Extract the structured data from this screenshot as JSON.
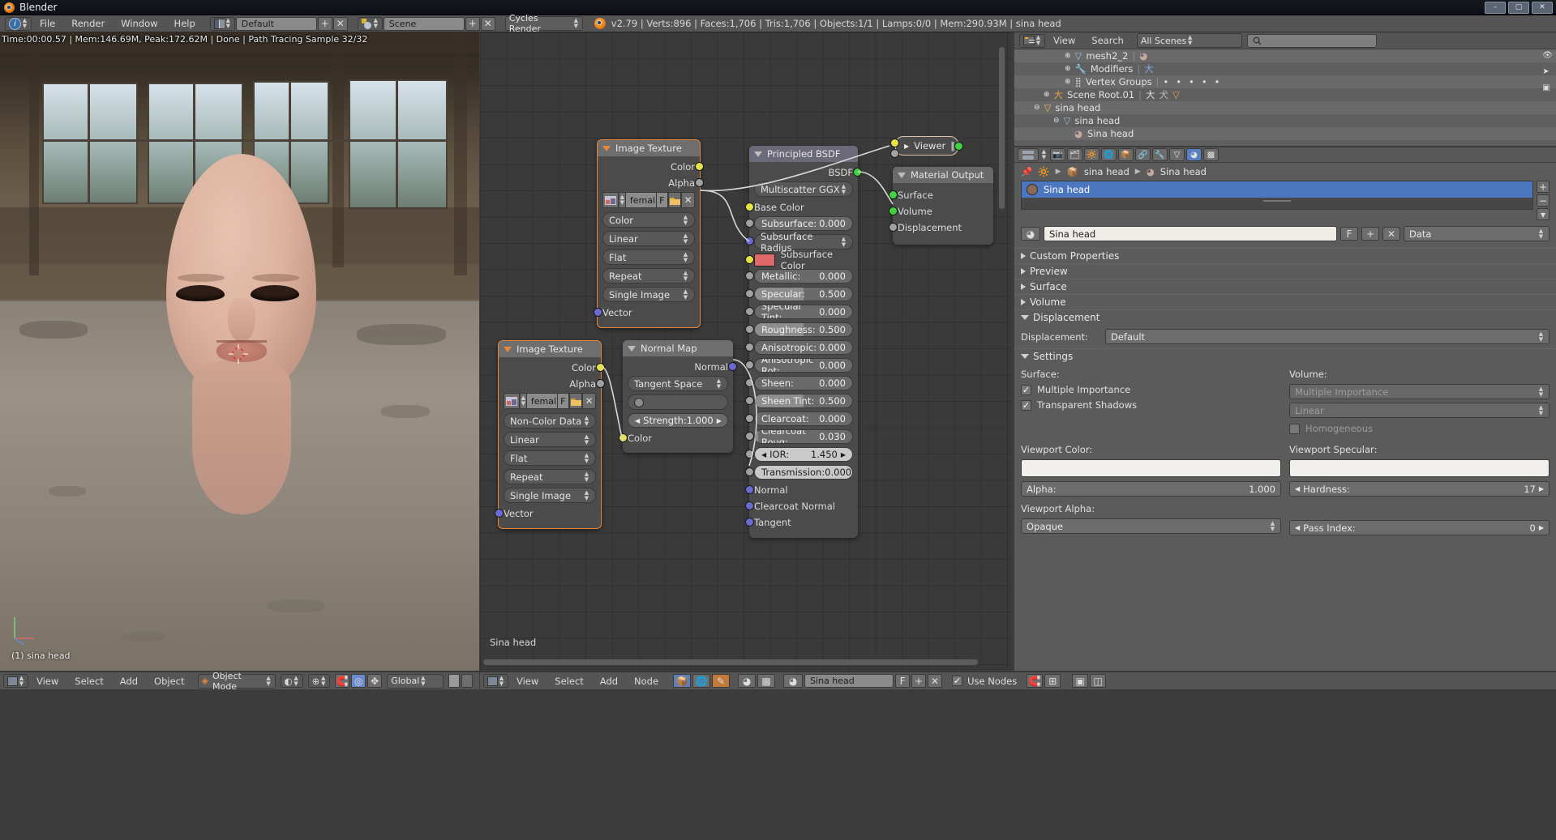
{
  "window": {
    "title": "Blender",
    "min": "–",
    "max": "▢",
    "close": "✕"
  },
  "topbar": {
    "menus": [
      "File",
      "Render",
      "Window",
      "Help"
    ],
    "screen_layout": "Default",
    "scene": "Scene",
    "engine": "Cycles Render",
    "add_label": "+",
    "remove_label": "✕",
    "stats": "v2.79 | Verts:896 | Faces:1,706 | Tris:1,706 | Objects:1/1 | Lamps:0/0 | Mem:290.93M | sina head"
  },
  "viewport": {
    "render_info": "Time:00:00.57 | Mem:146.69M, Peak:172.62M | Done | Path Tracing Sample 32/32",
    "object_label": "(1) sina head"
  },
  "node_editor": {
    "footer": "Sina head",
    "nodes": {
      "image_texture_1": {
        "title": "Image Texture",
        "outputs": [
          "Color",
          "Alpha"
        ],
        "image_name": "femal",
        "fake_user": "F",
        "enums": [
          "Color",
          "Linear",
          "Flat",
          "Repeat",
          "Single Image"
        ],
        "inputs": [
          "Vector"
        ]
      },
      "image_texture_2": {
        "title": "Image Texture",
        "outputs": [
          "Color",
          "Alpha"
        ],
        "image_name": "femal",
        "fake_user": "F",
        "enums": [
          "Non-Color Data",
          "Linear",
          "Flat",
          "Repeat",
          "Single Image"
        ],
        "inputs": [
          "Vector"
        ]
      },
      "normal_map": {
        "title": "Normal Map",
        "outputs": [
          "Normal"
        ],
        "space": "Tangent Space",
        "uv_map": "",
        "strength_label": "Strength:",
        "strength_value": "1.000",
        "inputs": [
          "Color"
        ]
      },
      "principled_bsdf": {
        "title": "Principled BSDF",
        "outputs": [
          "BSDF"
        ],
        "distribution": "Multiscatter GGX",
        "base_color_label": "Base Color",
        "subsurface_radius_label": "Subsurface Radius",
        "subsurface_color_label": "Subsurface Color",
        "subsurface_color_hex": "#e06a6a",
        "sliders": [
          {
            "label": "Subsurface:",
            "value": "0.000",
            "fill": 0
          },
          {
            "label": "Metallic:",
            "value": "0.000",
            "fill": 0
          },
          {
            "label": "Specular:",
            "value": "0.500",
            "fill": 50
          },
          {
            "label": "Specular Tint:",
            "value": "0.000",
            "fill": 0
          },
          {
            "label": "Roughness:",
            "value": "0.500",
            "fill": 50
          },
          {
            "label": "Anisotropic:",
            "value": "0.000",
            "fill": 0
          },
          {
            "label": "Anisotropic Rot:",
            "value": "0.000",
            "fill": 0
          },
          {
            "label": "Sheen:",
            "value": "0.000",
            "fill": 0
          },
          {
            "label": "Sheen Tint:",
            "value": "0.500",
            "fill": 50
          },
          {
            "label": "Clearcoat:",
            "value": "0.000",
            "fill": 0
          },
          {
            "label": "Clearcoat Roug:",
            "value": "0.030",
            "fill": 3
          },
          {
            "label": "IOR:",
            "value": "1.450",
            "fill": 0
          },
          {
            "label": "Transmission:",
            "value": "0.000",
            "fill": 0
          }
        ],
        "vector_inputs": [
          "Normal",
          "Clearcoat Normal",
          "Tangent"
        ]
      },
      "viewer": {
        "title": "Viewer",
        "pause": "‖"
      },
      "material_output": {
        "title": "Material Output",
        "inputs": [
          "Surface",
          "Volume",
          "Displacement"
        ]
      }
    }
  },
  "outliner": {
    "menus": [
      "View",
      "Search"
    ],
    "scope": "All Scenes",
    "search_placeholder": "",
    "rows": [
      {
        "label": "mesh2_2",
        "indent": 62,
        "icon": "mesh-icon"
      },
      {
        "label": "Modifiers",
        "indent": 62,
        "icon": "wrench-icon"
      },
      {
        "label": "Vertex Groups",
        "indent": 62,
        "icon": "group-icon"
      },
      {
        "label": "Scene Root.01",
        "indent": 36,
        "icon": "armature-icon"
      },
      {
        "label": "sina head",
        "indent": 24,
        "icon": "object-icon"
      },
      {
        "label": "sina head",
        "indent": 48,
        "icon": "mesh-icon"
      },
      {
        "label": "Sina head",
        "indent": 68,
        "icon": "material-icon"
      }
    ]
  },
  "properties": {
    "breadcrumb": {
      "object": "sina head",
      "material": "Sina head"
    },
    "material_slot": "Sina head",
    "datablock": {
      "name": "Sina head",
      "fake_user": "F",
      "new": "+",
      "unlink": "✕",
      "type": "Data"
    },
    "panels": [
      {
        "label": "Custom Properties",
        "open": false
      },
      {
        "label": "Preview",
        "open": false
      },
      {
        "label": "Surface",
        "open": false
      },
      {
        "label": "Volume",
        "open": false
      },
      {
        "label": "Displacement",
        "open": true
      },
      {
        "label": "Settings",
        "open": true
      }
    ],
    "displacement": {
      "label": "Displacement:",
      "value": "Default"
    },
    "settings": {
      "surface_label": "Surface:",
      "volume_label": "Volume:",
      "multiple_importance": "Multiple Importance",
      "transparent_shadows": "Transparent Shadows",
      "volume_sampling": "Multiple Importance",
      "volume_interpolation": "Linear",
      "homogeneous": "Homogeneous",
      "viewport_color_label": "Viewport Color:",
      "viewport_specular_label": "Viewport Specular:",
      "alpha_label": "Alpha:",
      "alpha_value": "1.000",
      "hardness_label": "Hardness:",
      "hardness_value": "17",
      "viewport_alpha_label": "Viewport Alpha:",
      "viewport_alpha_value": "Opaque",
      "pass_index_label": "Pass Index:",
      "pass_index_value": "0"
    }
  },
  "footer_3d": {
    "menus": [
      "View",
      "Select",
      "Add",
      "Object"
    ],
    "mode": "Object Mode",
    "transform_orientation": "Global"
  },
  "footer_node": {
    "menus": [
      "View",
      "Select",
      "Add",
      "Node"
    ],
    "material": "Sina head",
    "fake_user": "F",
    "use_nodes": "Use Nodes"
  },
  "colors": {
    "accent_orange": "#e8873a",
    "socket_yellow": "#e4e34a",
    "socket_gray": "#a1a1a1",
    "socket_purple": "#6a6ad0",
    "socket_green": "#3fd43f",
    "select_blue": "#4b77c0"
  }
}
